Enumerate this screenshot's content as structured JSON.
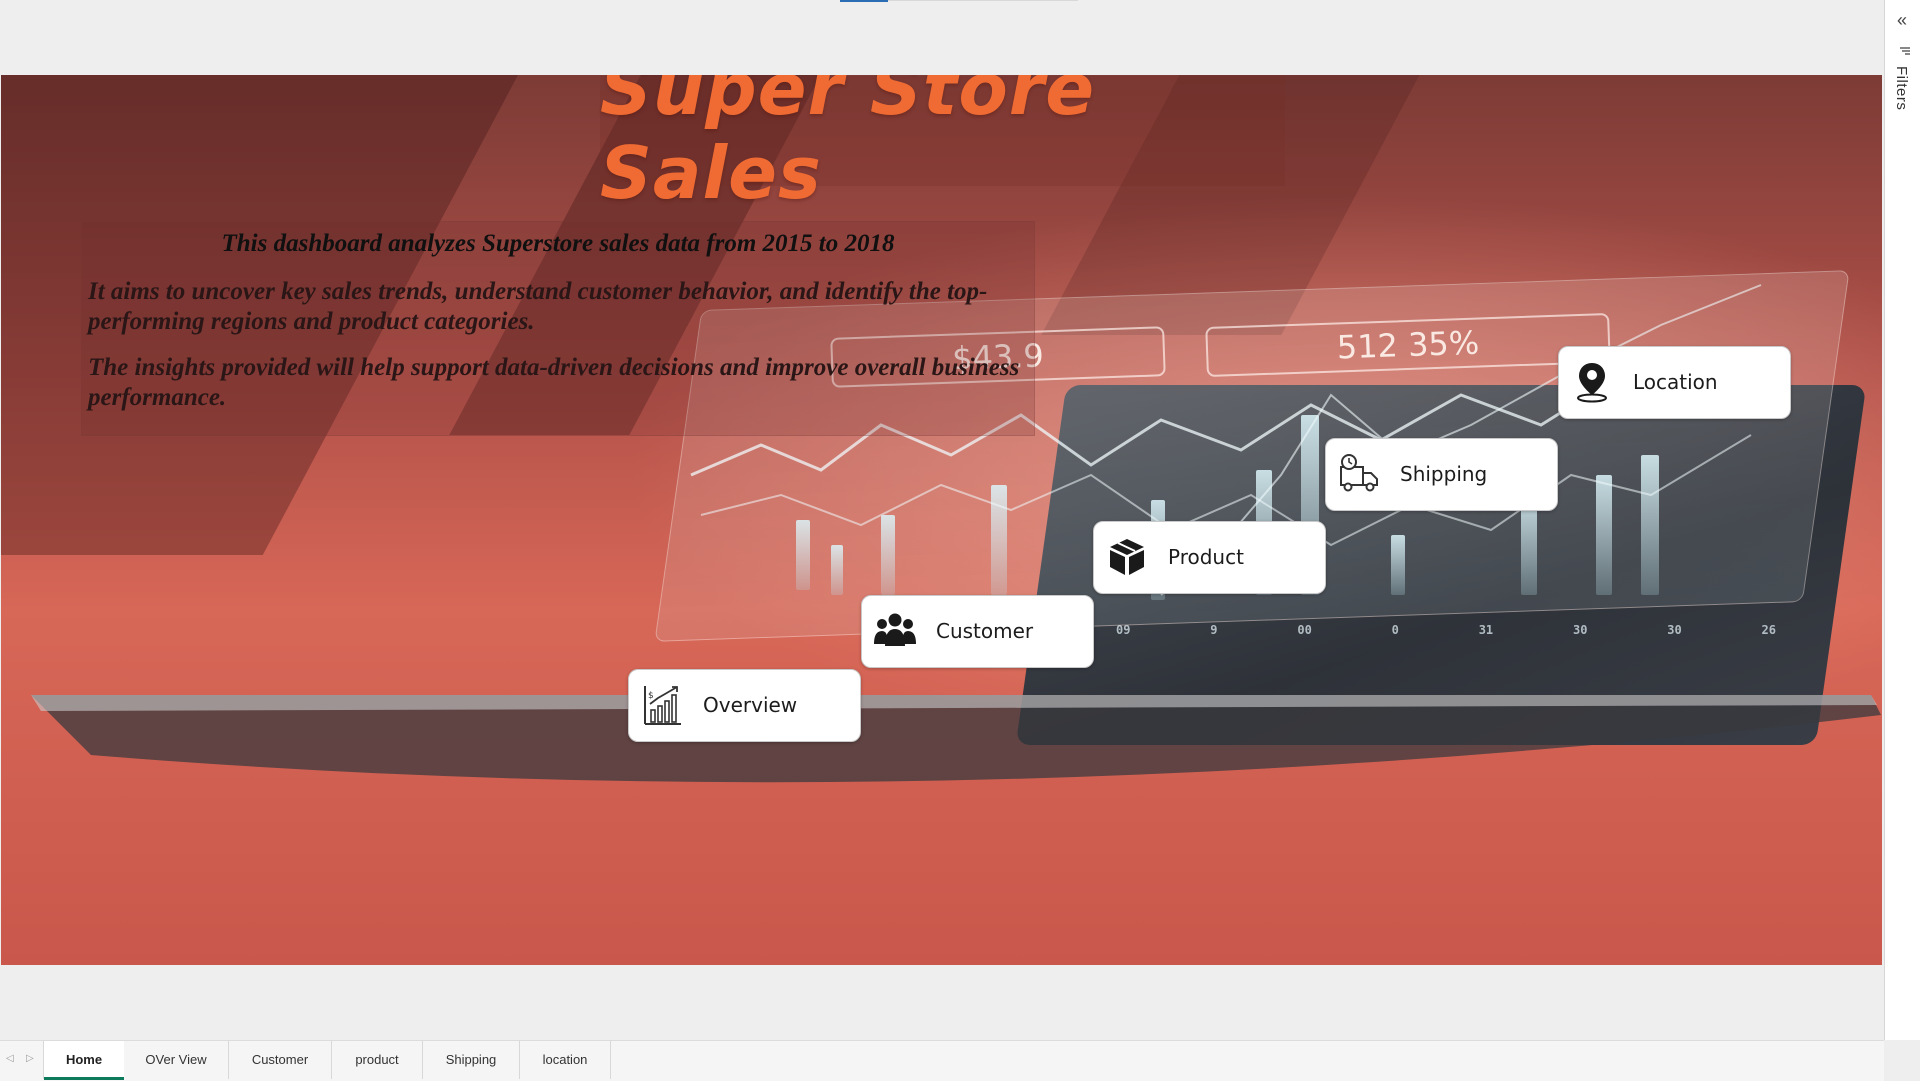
{
  "title": "Super Store Sales",
  "description": {
    "line1": "This dashboard analyzes Superstore sales data from 2015 to 2018",
    "line2": "It aims to uncover key sales trends, understand customer behavior, and identify the top-performing regions and product categories.",
    "line3": "The insights provided will help support data-driven decisions and improve overall business performance."
  },
  "background": {
    "value_a": "$43.9",
    "value_b": "512 35%",
    "axis_ticks": [
      "09",
      "9",
      "00",
      "0",
      "31",
      "30",
      "30",
      "26"
    ]
  },
  "nav_buttons": [
    {
      "label": "Overview",
      "icon": "bar-chart-growth-icon"
    },
    {
      "label": "Customer",
      "icon": "users-group-icon"
    },
    {
      "label": "Product",
      "icon": "package-box-icon"
    },
    {
      "label": "Shipping",
      "icon": "delivery-truck-clock-icon"
    },
    {
      "label": "Location",
      "icon": "map-pin-icon"
    }
  ],
  "filters_panel": {
    "label": "Filters",
    "collapse_icon": "double-chevron-left-icon",
    "filter_icon": "filter-icon"
  },
  "tabs": [
    {
      "label": "Home",
      "active": true
    },
    {
      "label": "OVer View",
      "active": false
    },
    {
      "label": "Customer",
      "active": false
    },
    {
      "label": "product",
      "active": false
    },
    {
      "label": "Shipping",
      "active": false
    },
    {
      "label": "location",
      "active": false
    }
  ],
  "colors": {
    "title": "#ef6b33",
    "active_tab_underline": "#0e7a5c",
    "canvas_base": "#d76757"
  }
}
